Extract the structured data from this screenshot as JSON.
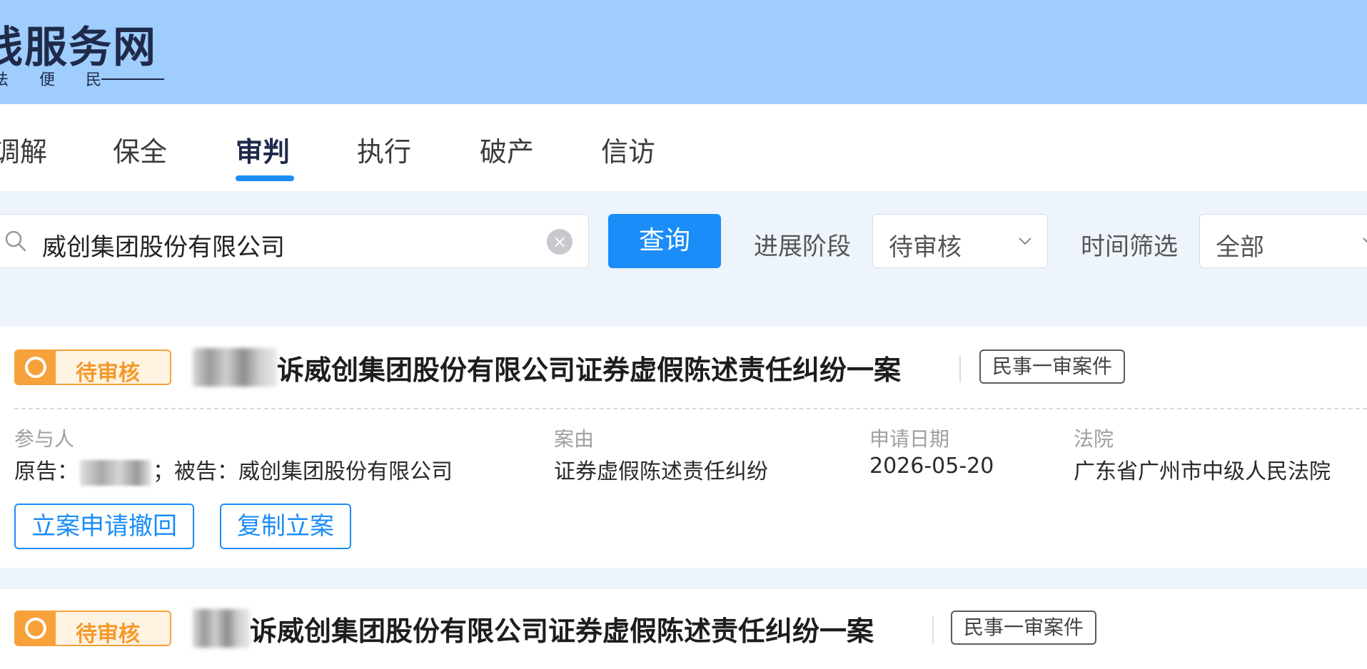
{
  "header": {
    "logo_title": "线服务网",
    "logo_subtitle": "法 便 民"
  },
  "nav": {
    "tabs": [
      {
        "label": "调解"
      },
      {
        "label": "保全"
      },
      {
        "label": "审判",
        "active": true
      },
      {
        "label": "执行"
      },
      {
        "label": "破产"
      },
      {
        "label": "信访"
      }
    ]
  },
  "filters": {
    "search_value": "威创集团股份有限公司",
    "clear_icon": "×",
    "query_label": "查询",
    "stage_label": "进展阶段",
    "stage_value": "待审核",
    "time_label": "时间筛选",
    "time_value": "全部"
  },
  "cases": [
    {
      "status": "待审核",
      "title": "诉威创集团股份有限公司证券虚假陈述责任纠纷一案",
      "case_type": "民事一审案件",
      "participants_label": "参与人",
      "participants_plaintiff_prefix": "原告：",
      "participants_defendant": "；被告：威创集团股份有限公司",
      "cause_label": "案由",
      "cause_value": "证券虚假陈述责任纠纷",
      "date_label": "申请日期",
      "date_value": "2026-05-20",
      "court_label": "法院",
      "court_value": "广东省广州市中级人民法院",
      "actions": [
        "立案申请撤回",
        "复制立案"
      ]
    },
    {
      "status": "待审核",
      "title": "诉威创集团股份有限公司证券虚假陈述责任纠纷一案",
      "case_type": "民事一审案件"
    }
  ],
  "colors": {
    "header_bg": "#9fcdfd",
    "accent": "#1a8df8",
    "status_orange": "#f7a13b"
  }
}
